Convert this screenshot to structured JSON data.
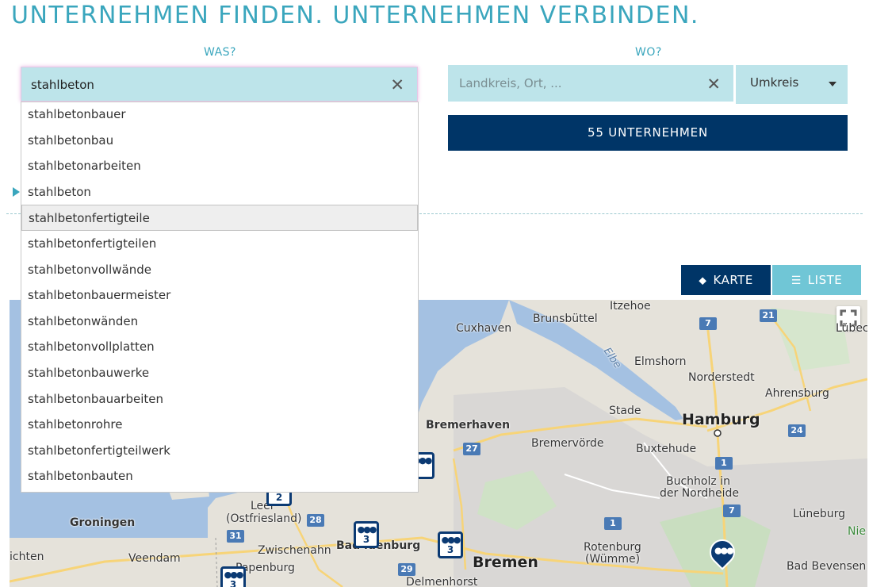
{
  "header": {
    "headline": "UNTERNEHMEN FINDEN. UNTERNEHMEN VERBINDEN."
  },
  "search": {
    "what_label": "WAS?",
    "where_label": "WO?",
    "query": "stahlbeton",
    "location_placeholder": "Landkreis, Ort, ...",
    "radius_label": "Umkreis",
    "count_button": "55 UNTERNEHMEN"
  },
  "suggestions": [
    "stahlbetonbauer",
    "stahlbetonbau",
    "stahlbetonarbeiten",
    "stahlbeton",
    "stahlbetonfertigteile",
    "stahlbetonfertigteilen",
    "stahlbetonvollwände",
    "stahlbetonbauermeister",
    "stahlbetonwänden",
    "stahlbetonvollplatten",
    "stahlbetonbauwerke",
    "stahlbetonbauarbeiten",
    "stahlbetonrohre",
    "stahlbetonfertigteilwerk",
    "stahlbetonbauten"
  ],
  "highlighted_suggestion": "stahlbetonfertigteile",
  "view_toggle": {
    "map_label": "KARTE",
    "list_label": "LISTE",
    "active": "KARTE"
  },
  "map": {
    "places": {
      "itzehoe": "Itzehoe",
      "brunsbuettel": "Brunsbüttel",
      "cuxhaven": "Cuxhaven",
      "elmshorn": "Elmshorn",
      "norderstedt": "Norderstedt",
      "ahrensburg": "Ahrensburg",
      "stade": "Stade",
      "hamburg": "Hamburg",
      "bremerhaven": "Bremerhaven",
      "bremervoerde": "Bremervörde",
      "buxtehude": "Buxtehude",
      "buchholz1": "Buchholz in",
      "buchholz2": "der Nordheide",
      "lueneburg": "Lüneburg",
      "groningen": "Groningen",
      "leer1": "Leer",
      "leer2": "(Ostfriesland)",
      "zwischenahn": "Zwischenahn",
      "oldenburg": "Bad  ldenburg",
      "bremen": "Bremen",
      "rotenburg1": "Rotenburg",
      "rotenburg2": "(Wümme)",
      "veendam": "Veendam",
      "papenburg": "Papenburg",
      "delmenhorst": "Delmenhorst",
      "bad_bevensen": "Bad Bevensen",
      "luebeck": "Lübeck",
      "elbe": "Elbe",
      "lichten": "ichten",
      "nie": "Nie"
    },
    "roads": [
      "7",
      "21",
      "27",
      "24",
      "1",
      "7",
      "1",
      "28",
      "31",
      "29"
    ],
    "clusters": [
      "2",
      "3",
      "3",
      "3"
    ]
  }
}
